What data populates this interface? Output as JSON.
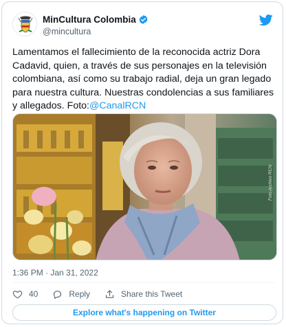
{
  "tweet": {
    "display_name": "MinCultura Colombia",
    "handle": "@mincultura",
    "text_before_mention": "Lamentamos el fallecimiento de la reconocida actriz Dora Cadavid, quien, a través de sus personajes en la televisión colombiana, así como su trabajo radial, deja un gran legado para nuestra cultura. Nuestras condolencias a sus familiares y allegados. Foto:",
    "mention": "@CanalRCN",
    "photo_credit": "Foto Archivo RCN",
    "timestamp": "1:36 PM · Jan 31, 2022",
    "like_count": "40",
    "reply_label": "Reply",
    "share_label": "Share this Tweet",
    "explore_label": "Explore what's happening on Twitter"
  },
  "icons": {
    "verified": "verified-badge-icon",
    "twitter": "twitter-bird-icon",
    "like": "heart-icon",
    "reply": "reply-bubble-icon",
    "share": "share-arrow-icon"
  },
  "colors": {
    "accent": "#1d9bf0",
    "text": "#0f1419",
    "secondary_text": "#536471",
    "border": "#cfd9de"
  }
}
